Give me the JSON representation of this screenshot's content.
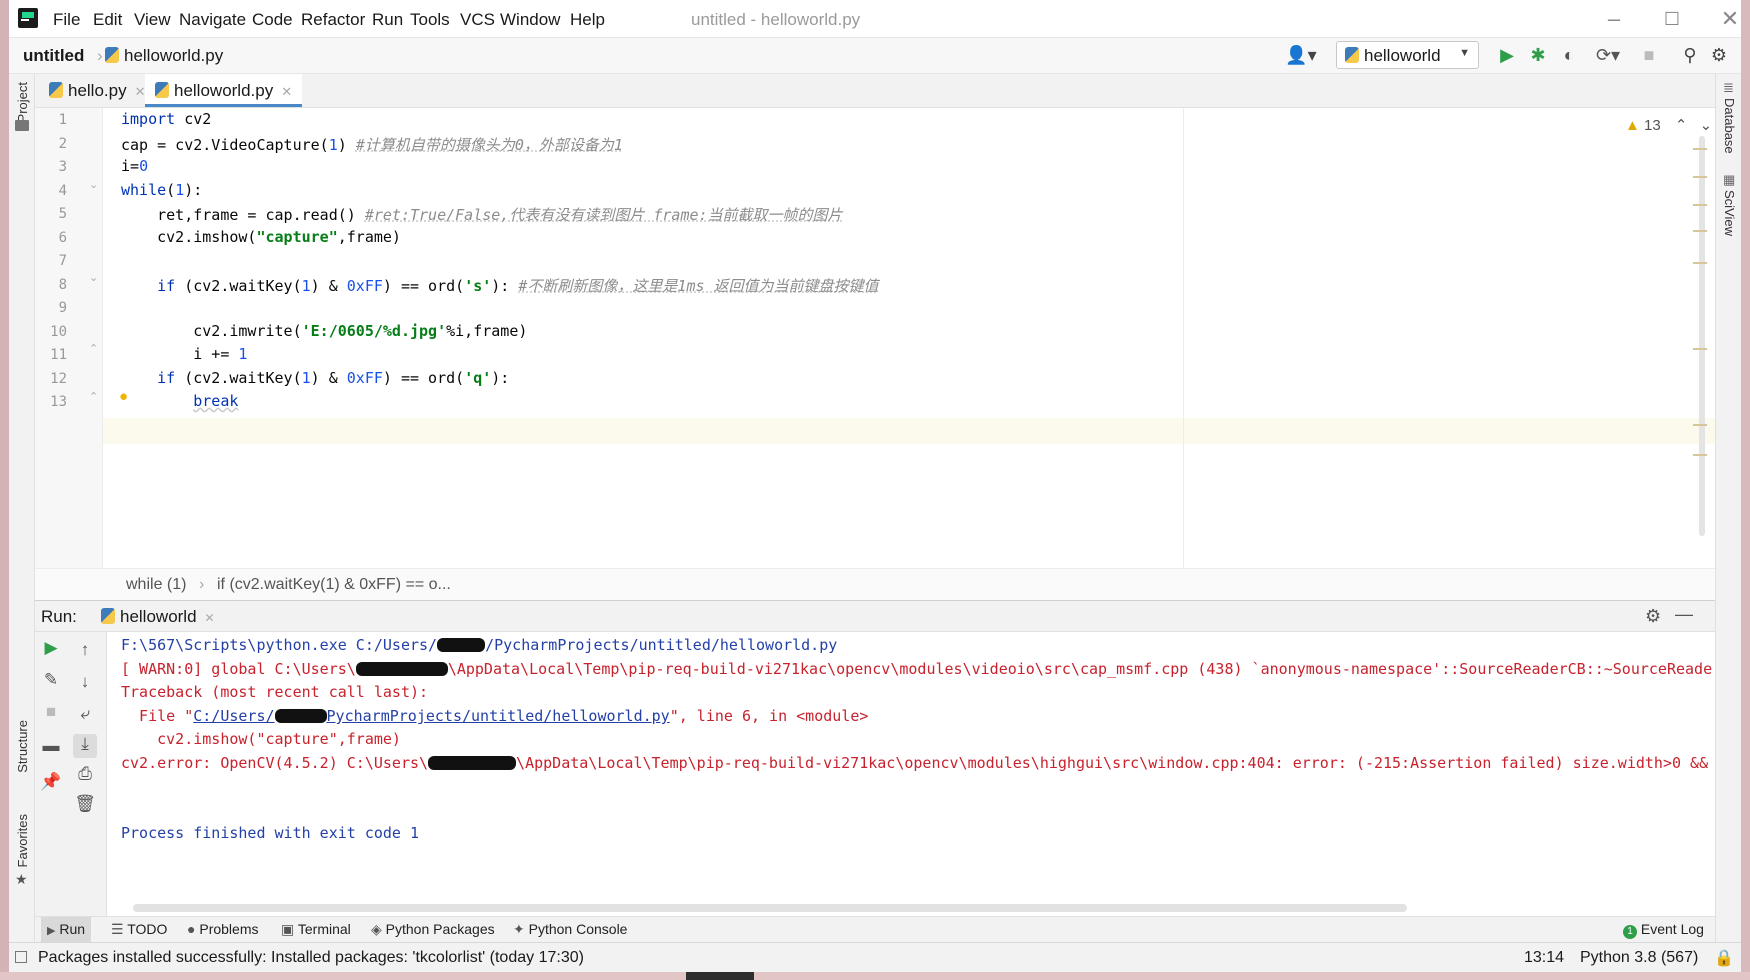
{
  "window": {
    "title": "untitled - helloworld.py"
  },
  "menu": [
    "File",
    "Edit",
    "View",
    "Navigate",
    "Code",
    "Refactor",
    "Run",
    "Tools",
    "VCS",
    "Window",
    "Help"
  ],
  "nav": {
    "project": "untitled",
    "file": "helloworld.py",
    "run_config": "helloworld"
  },
  "tabs": [
    {
      "label": "hello.py",
      "active": false
    },
    {
      "label": "helloworld.py",
      "active": true
    }
  ],
  "side_left": [
    "Project",
    "Structure",
    "Favorites"
  ],
  "side_right": [
    "Database",
    "SciView"
  ],
  "editor": {
    "warnings": "13",
    "lines": [
      "1",
      "2",
      "3",
      "4",
      "5",
      "6",
      "7",
      "8",
      "9",
      "10",
      "11",
      "12",
      "13"
    ],
    "code": {
      "l1a": "import",
      "l1b": " cv2",
      "l2a": "cap = cv2.VideoCapture(",
      "l2b": "1",
      "l2c": ") ",
      "l2d": "#计算机自带的摄像头为0，外部设备为1",
      "l3a": "i=",
      "l3b": "0",
      "l4a": "while",
      "l4b": "(",
      "l4c": "1",
      "l4d": "):",
      "l5a": "    ret,frame = cap.read() ",
      "l5b": "#ret:True/False,代表有没有读到图片 frame:当前截取一帧的图片",
      "l6a": "    cv2.imshow(",
      "l6b": "\"capture\"",
      "l6c": ",frame)",
      "l8a": "    ",
      "l8b": "if",
      "l8c": " (cv2.waitKey(",
      "l8d": "1",
      "l8e": ") & ",
      "l8f": "0xFF",
      "l8g": ") == ord(",
      "l8h": "'s'",
      "l8i": "): ",
      "l8j": "#不断刷新图像，这里是1ms 返回值为当前键盘按键值",
      "l10a": "        cv2.imwrite(",
      "l10b": "'E:/0605/%d.jpg'",
      "l10c": "%i,frame)",
      "l11a": "        i += ",
      "l11b": "1",
      "l12a": "    ",
      "l12b": "if",
      "l12c": " (cv2.waitKey(",
      "l12d": "1",
      "l12e": ") & ",
      "l12f": "0xFF",
      "l12g": ") == ord(",
      "l12h": "'q'",
      "l12i": "):",
      "l13a": "        ",
      "l13b": "break"
    },
    "breadcrumb": [
      "while (1)",
      "if (cv2.waitKey(1) & 0xFF) == o..."
    ]
  },
  "run": {
    "label": "Run:",
    "tab": "helloworld",
    "output": {
      "o1a": "F:\\567\\Scripts\\python.exe C:/Users/",
      "o1b": "/PycharmProjects/untitled/helloworld.py",
      "o2a": "[ WARN:0] global C:\\Users\\",
      "o2b": "\\AppData\\Local\\Temp\\pip-req-build-vi271kac\\opencv\\modules\\videoio\\src\\cap_msmf.cpp (438) `anonymous-namespace'::SourceReaderCB::~SourceReade",
      "o3": "Traceback (most recent call last):",
      "o4a": "  File \"",
      "o4b": "C:/Users/",
      "o4c": "PycharmProjects/untitled/helloworld.py",
      "o4d": "\", line 6, in <module>",
      "o5": "    cv2.imshow(\"capture\",frame)",
      "o6a": "cv2.error: OpenCV(4.5.2) C:\\Users\\",
      "o6b": "\\AppData\\Local\\Temp\\pip-req-build-vi271kac\\opencv\\modules\\highgui\\src\\window.cpp:404: error: (-215:Assertion failed) size.width>0 &&",
      "o7": "Process finished with exit code 1"
    }
  },
  "bottom_tabs": [
    "Run",
    "TODO",
    "Problems",
    "Terminal",
    "Python Packages",
    "Python Console"
  ],
  "event_log": {
    "count": "1",
    "label": "Event Log"
  },
  "status": {
    "message": "Packages installed successfully: Installed packages: 'tkcolorlist' (today 17:30)",
    "position": "13:14",
    "interpreter": "Python 3.8 (567)"
  },
  "colors": {
    "accent": "#4a88c7",
    "run_green": "#2e9e4b",
    "error_red": "#c7222d",
    "console_blue": "#2440a8"
  }
}
